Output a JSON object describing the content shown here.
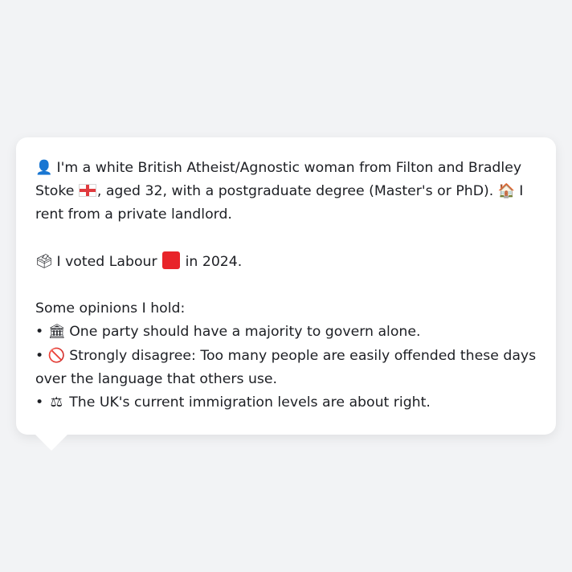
{
  "profile": {
    "intro_icon": "person-silhouette-icon",
    "intro_text_1": " I'm a white British Atheist/Agnostic woman from Filton and Bradley Stoke ",
    "flag_icon": "england-flag-icon",
    "intro_text_2": ", aged 32, with a postgraduate degree (Master's or PhD). ",
    "home_icon": "house-icon",
    "intro_text_3": " I rent from a private landlord."
  },
  "vote": {
    "ballot_icon": "ballot-box-icon",
    "text_before": " I voted Labour ",
    "party_color": "#e8242a",
    "party_icon": "red-square-icon",
    "text_after": " in 2024."
  },
  "opinions": {
    "heading": "Some opinions I hold:",
    "bullet": "•",
    "items": [
      {
        "icon": "classical-building-icon",
        "glyph": "🏛",
        "text": " One party should have a majority to govern alone."
      },
      {
        "icon": "prohibited-icon",
        "glyph": "🚫",
        "text": " Strongly disagree: Too many people are easily offended these days over the language that others use."
      },
      {
        "icon": "balance-scale-icon",
        "glyph": "⚖",
        "text": " The UK's current immigration levels are about right."
      }
    ]
  }
}
